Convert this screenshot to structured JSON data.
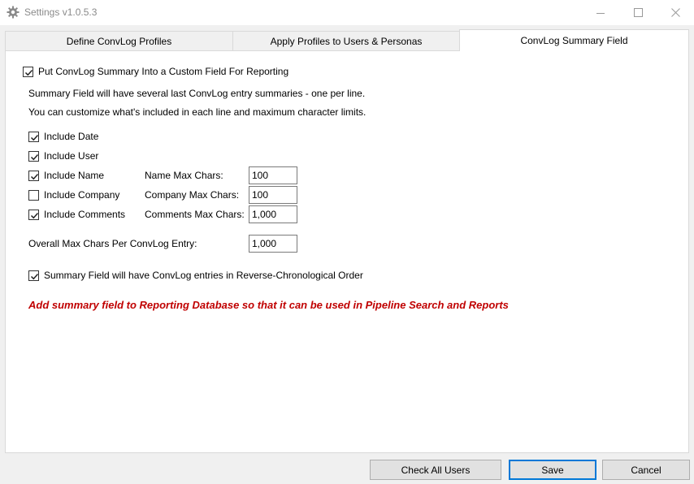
{
  "window": {
    "title": "Settings v1.0.5.3",
    "app_icon": "gear-icon"
  },
  "tabs": [
    {
      "label": "Define ConvLog Profiles",
      "selected": false
    },
    {
      "label": "Apply Profiles to Users & Personas",
      "selected": false
    },
    {
      "label": "ConvLog Summary Field",
      "selected": true
    }
  ],
  "summary": {
    "put_in_custom_field": {
      "label": "Put ConvLog Summary Into a Custom Field For Reporting",
      "checked": true
    },
    "desc_line1": "Summary Field will have several last ConvLog entry summaries - one per line.",
    "desc_line2": "You can customize what's included in each line and maximum character limits.",
    "include_date": {
      "label": "Include Date",
      "checked": true
    },
    "include_user": {
      "label": "Include User",
      "checked": true
    },
    "include_name": {
      "label": "Include Name",
      "checked": true
    },
    "include_company": {
      "label": "Include Company",
      "checked": false
    },
    "include_comments": {
      "label": "Include Comments",
      "checked": true
    },
    "name_max": {
      "label": "Name Max Chars:",
      "value": "100"
    },
    "company_max": {
      "label": "Company Max Chars:",
      "value": "100"
    },
    "comments_max": {
      "label": "Comments Max Chars:",
      "value": "1,000"
    },
    "overall_max": {
      "label": "Overall Max Chars Per ConvLog Entry:",
      "value": "1,000"
    },
    "reverse_order": {
      "label": "Summary Field will have ConvLog entries in Reverse-Chronological Order",
      "checked": true
    },
    "note": "Add summary field to Reporting Database so that it can be used in Pipeline Search and Reports",
    "note_color": "#c00000"
  },
  "buttons": {
    "check_all": "Check All Users",
    "save": "Save",
    "cancel": "Cancel"
  },
  "colors": {
    "accent": "#0078d7"
  }
}
